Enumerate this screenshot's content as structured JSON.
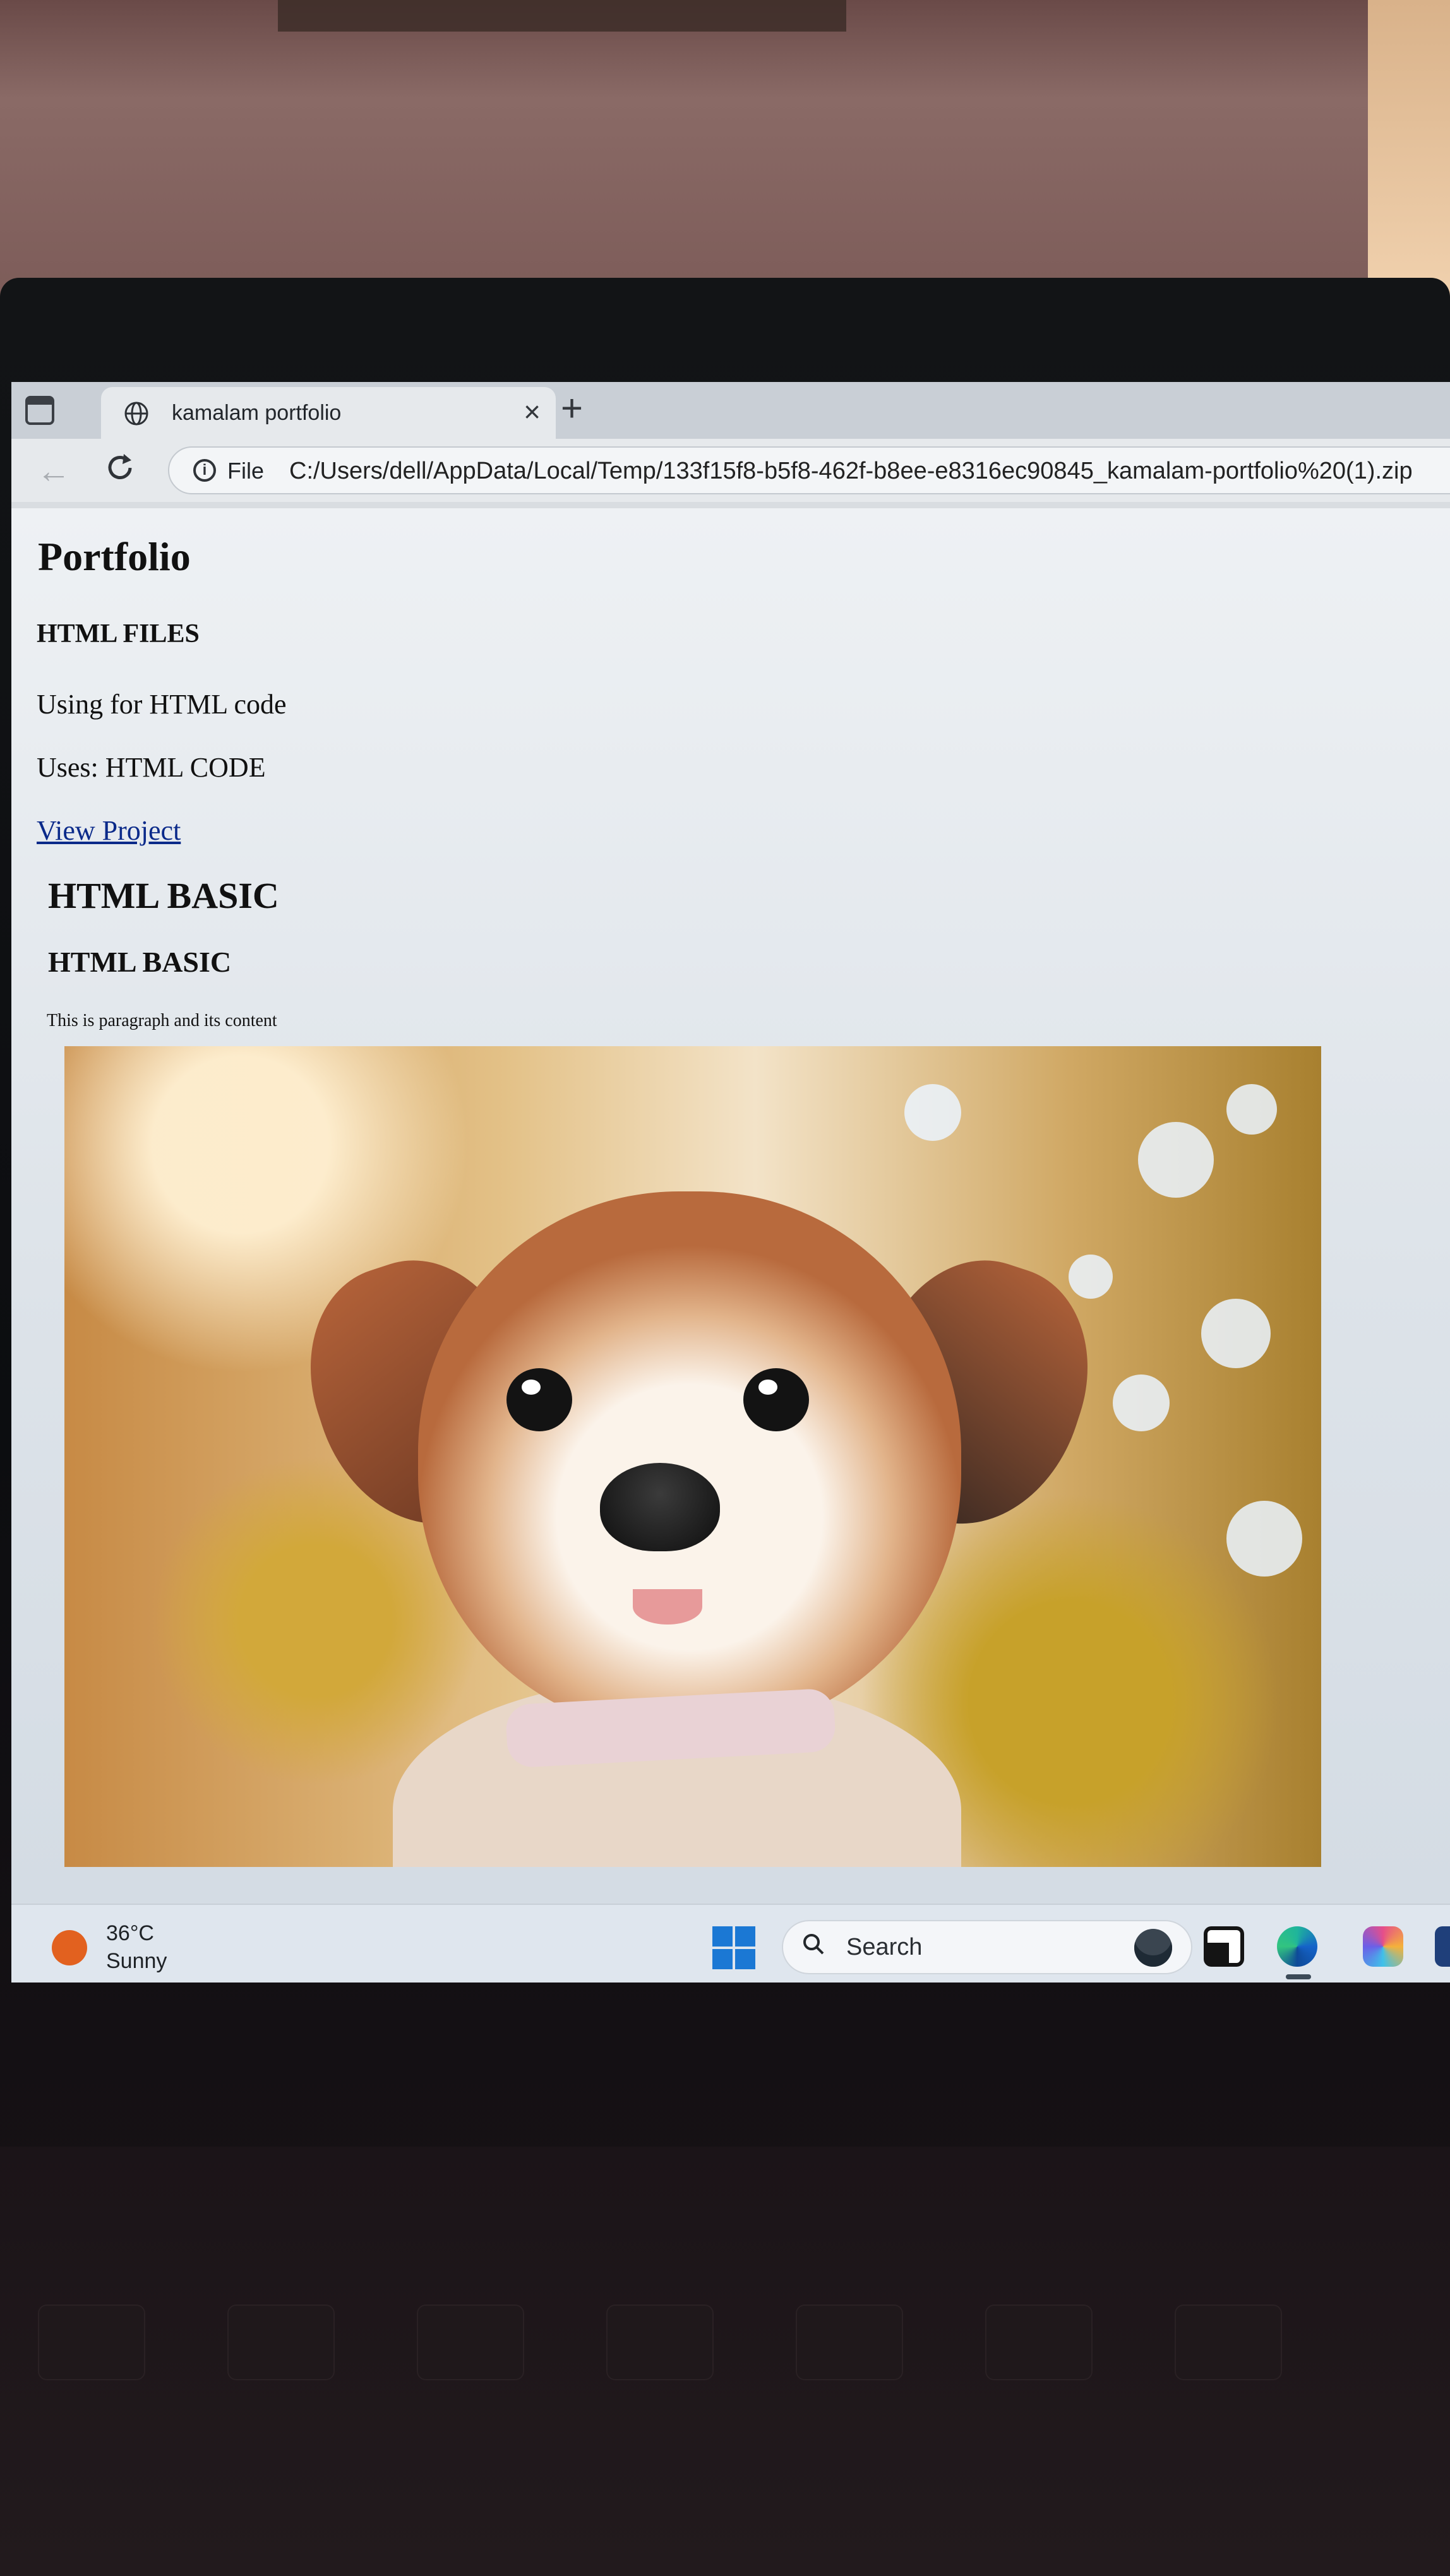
{
  "browser": {
    "tab_title": "kamalam portfolio",
    "tab_close": "×",
    "new_tab": "+",
    "file_label": "File",
    "url": "C:/Users/dell/AppData/Local/Temp/133f15f8-b5f8-462f-b8ee-e8316ec90845_kamalam-portfolio%20(1).zip"
  },
  "page": {
    "title": "Portfolio",
    "section_heading": "HTML FILES",
    "para1": "Using for HTML code",
    "para2": "Uses: HTML CODE",
    "link": "View Project",
    "h2": "HTML BASIC",
    "h3": "HTML BASIC",
    "small_text": "This is paragraph and its content",
    "image_subject": "puppy photo"
  },
  "taskbar": {
    "temperature": "36°C",
    "condition": "Sunny",
    "search_label": "Search"
  },
  "colors": {
    "link": "#0b2a8a",
    "weather_icon": "#e2611f",
    "start_button": "#1b78d4"
  }
}
